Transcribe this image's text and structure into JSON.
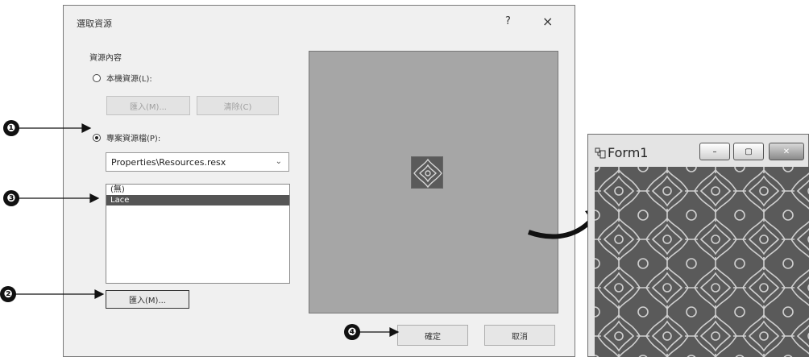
{
  "dialog": {
    "title": "選取資源",
    "help_glyph": "?",
    "close_glyph": "×",
    "group_label": "資源內容",
    "radio_local_label": "本機資源(L):",
    "local_import_label": "匯入(M)...",
    "local_clear_label": "清除(C)",
    "radio_project_label": "專案資源檔(P):",
    "combo_value": "Properties\\Resources.resx",
    "combo_arrow": "⌄",
    "list_items": [
      "(無)",
      "Lace"
    ],
    "import_label": "匯入(M)...",
    "ok_label": "確定",
    "cancel_label": "取消"
  },
  "callouts": {
    "one": "❶",
    "two": "❷",
    "three": "❸",
    "four": "❹"
  },
  "form1": {
    "title": "Form1",
    "minimize_glyph": "–",
    "maximize_glyph": "▢",
    "close_glyph": "✕"
  },
  "colors": {
    "dialog_bg": "#f0f0f0",
    "preview_bg": "#a6a6a6",
    "selection": "#555555",
    "pattern_dark": "#5a5a5a",
    "pattern_light": "#cfcfcf"
  }
}
